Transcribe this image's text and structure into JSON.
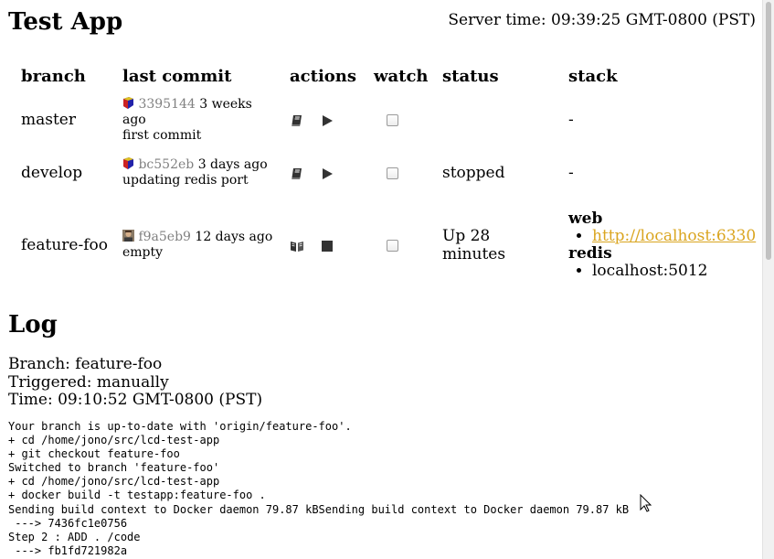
{
  "app": {
    "title": "Test App"
  },
  "server_time": {
    "label": "Server time:",
    "value": "09:39:25 GMT-0800 (PST)"
  },
  "table": {
    "headers": {
      "branch": "branch",
      "last_commit": "last commit",
      "actions": "actions",
      "watch": "watch",
      "status": "status",
      "stack": "stack"
    },
    "rows": [
      {
        "branch": "master",
        "sha": "3395144",
        "age": "3 weeks ago",
        "message": "first commit",
        "status": "",
        "stack_empty": "-",
        "avatar": "cube-avatar",
        "actions": [
          "book-icon",
          "play-icon"
        ]
      },
      {
        "branch": "develop",
        "sha": "bc552eb",
        "age": "3 days ago",
        "message": "updating redis port",
        "status": "stopped",
        "stack_empty": "-",
        "avatar": "cube-avatar",
        "actions": [
          "book-icon",
          "play-icon"
        ]
      },
      {
        "branch": "feature-foo",
        "sha": "f9a5eb9",
        "age": "12 days ago",
        "message": "empty",
        "status": "Up 28 minutes",
        "avatar": "photo-avatar",
        "actions": [
          "open-book-icon",
          "stop-icon"
        ],
        "stack": {
          "web": {
            "name": "web",
            "item": "http://localhost:6330"
          },
          "redis": {
            "name": "redis",
            "item": "localhost:5012"
          }
        }
      }
    ]
  },
  "log": {
    "title": "Log",
    "branch_line": "Branch: feature-foo",
    "triggered_line": "Triggered: manually",
    "time_line": "Time: 09:10:52 GMT-0800 (PST)",
    "output": "Your branch is up-to-date with 'origin/feature-foo'.\n+ cd /home/jono/src/lcd-test-app\n+ git checkout feature-foo\nSwitched to branch 'feature-foo'\n+ cd /home/jono/src/lcd-test-app\n+ docker build -t testapp:feature-foo .\nSending build context to Docker daemon 79.87 kBSending build context to Docker daemon 79.87 kB\n ---> 7436fc1e0756\nStep 2 : ADD . /code\n ---> fb1fd721982a"
  },
  "colors": {
    "link": "#daa520",
    "sha": "#808080"
  }
}
